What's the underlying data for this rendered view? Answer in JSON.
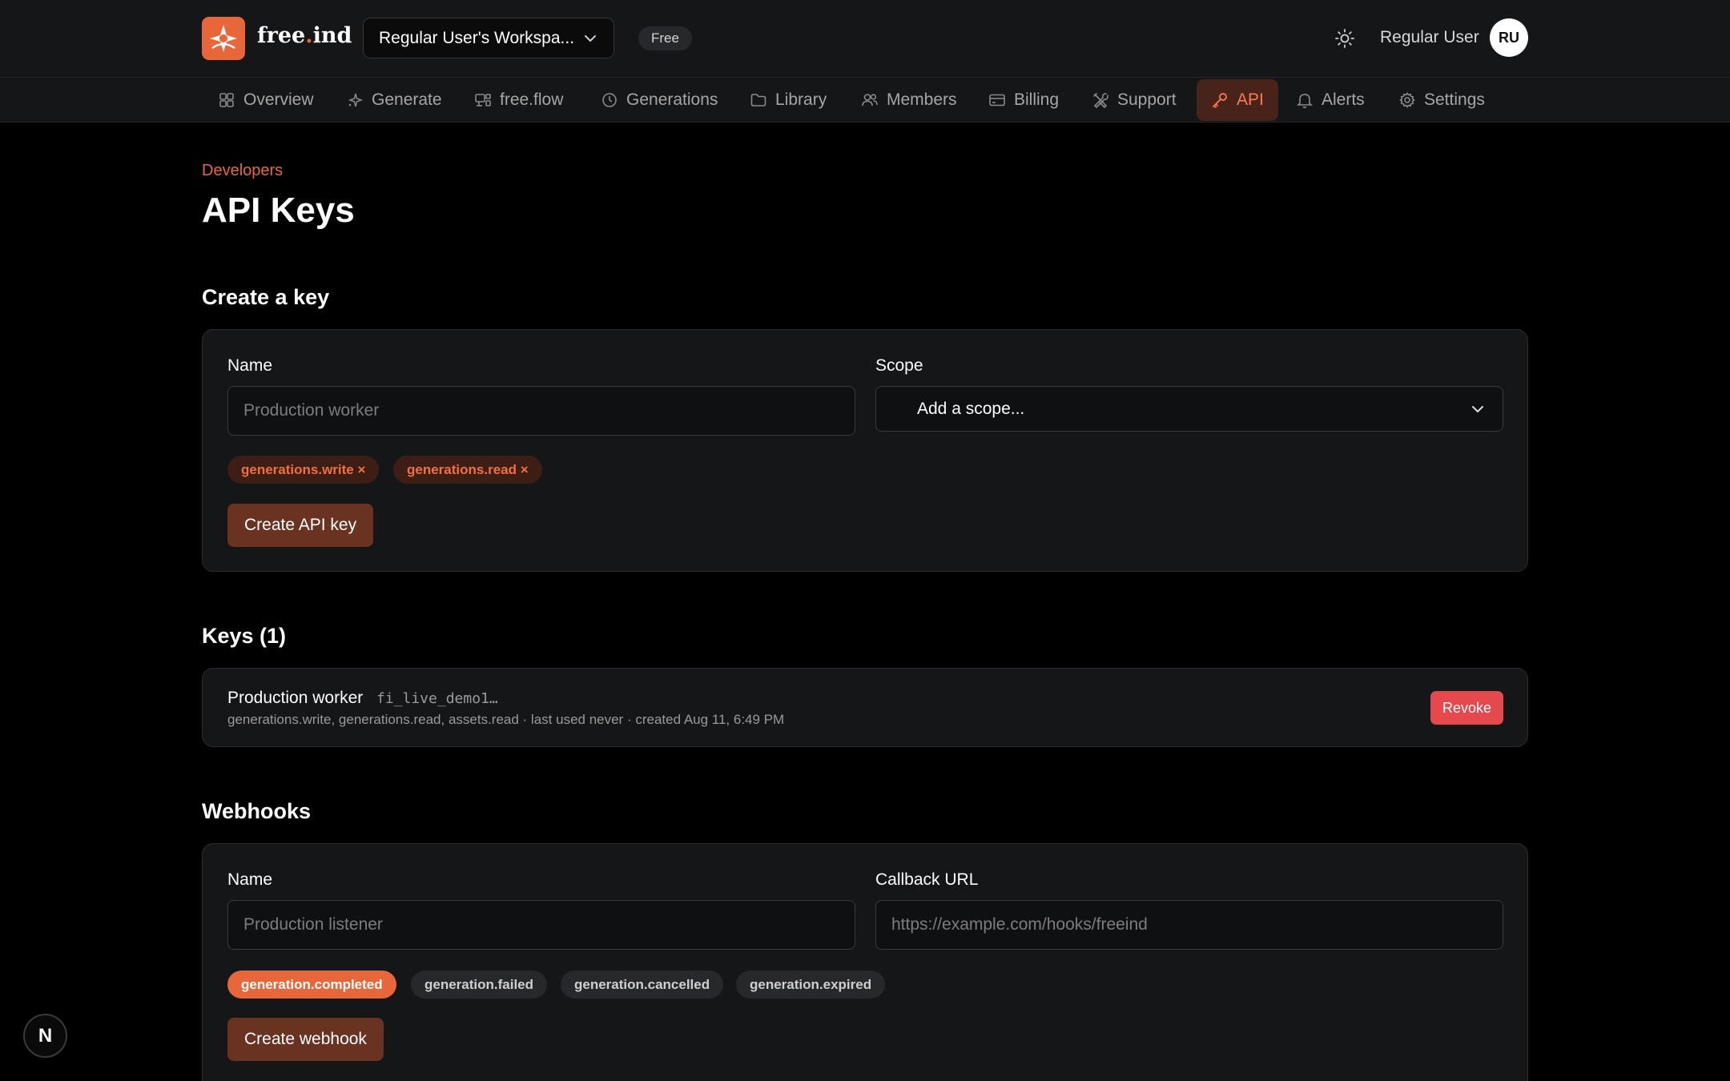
{
  "header": {
    "brand_prefix": "free",
    "brand_dot": ".",
    "brand_suffix": "ind",
    "workspace_name": "Regular User's Workspa...",
    "plan": "Free",
    "user_name": "Regular User",
    "user_initials": "RU",
    "accent_color": "#e8673a"
  },
  "nav": {
    "items": [
      {
        "label": "Overview",
        "icon": "grid-icon"
      },
      {
        "label": "Generate",
        "icon": "sparkle-icon"
      },
      {
        "label": "free.flow",
        "icon": "flow-icon"
      },
      {
        "label": "Generations",
        "icon": "clock-icon"
      },
      {
        "label": "Library",
        "icon": "folder-icon"
      },
      {
        "label": "Members",
        "icon": "users-icon"
      },
      {
        "label": "Billing",
        "icon": "card-icon"
      },
      {
        "label": "Support",
        "icon": "tools-icon"
      },
      {
        "label": "API",
        "icon": "key-icon",
        "active": true
      },
      {
        "label": "Alerts",
        "icon": "bell-icon"
      },
      {
        "label": "Settings",
        "icon": "gear-icon"
      }
    ]
  },
  "page": {
    "eyebrow": "Developers",
    "title": "API Keys"
  },
  "create_key": {
    "section_title": "Create a key",
    "name_label": "Name",
    "name_placeholder": "Production worker",
    "scope_label": "Scope",
    "scope_placeholder": "Add a scope...",
    "selected_scopes": [
      "generations.write ×",
      "generations.read ×"
    ],
    "submit_label": "Create API key"
  },
  "keys": {
    "section_title": "Keys (1)",
    "items": [
      {
        "name": "Production worker",
        "prefix": "fi_live_demo1…",
        "meta": "generations.write, generations.read, assets.read · last used never · created Aug 11, 6:49 PM",
        "revoke_label": "Revoke"
      }
    ]
  },
  "webhooks": {
    "section_title": "Webhooks",
    "name_label": "Name",
    "name_placeholder": "Production listener",
    "url_label": "Callback URL",
    "url_placeholder": "https://example.com/hooks/freeind",
    "events": [
      {
        "label": "generation.completed",
        "selected": true
      },
      {
        "label": "generation.failed",
        "selected": false
      },
      {
        "label": "generation.cancelled",
        "selected": false
      },
      {
        "label": "generation.expired",
        "selected": false
      }
    ],
    "submit_label": "Create webhook"
  },
  "dev_indicator": {
    "label": "N"
  }
}
